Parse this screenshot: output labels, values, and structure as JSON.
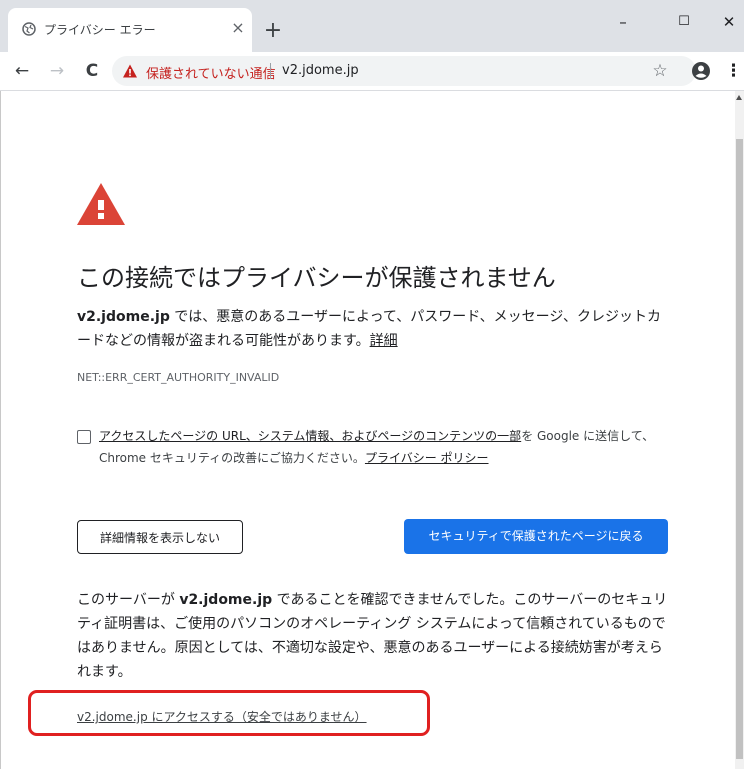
{
  "tab": {
    "title": "プライバシー エラー",
    "close_glyph": "×",
    "favicon": "globe-icon"
  },
  "newtab_glyph": "+",
  "window_controls": {
    "minimize": "–",
    "maximize": "☐",
    "close": "✕"
  },
  "toolbar": {
    "back_glyph": "←",
    "forward_glyph": "→",
    "reload_glyph": "C",
    "security_label": "保護されていない通信",
    "url": "v2.jdome.jp",
    "star_glyph": "☆",
    "menu_glyph": "⋮"
  },
  "page": {
    "heading": "この接続ではプライバシーが保護されません",
    "p1_domain": "v2.jdome.jp",
    "p1_text": " では、悪意のあるユーザーによって、パスワード、メッセージ、クレジットカードなどの情報が盗まれる可能性があります。",
    "p1_link": "詳細",
    "error_code": "NET::ERR_CERT_AUTHORITY_INVALID",
    "checkbox": {
      "checked": false,
      "text_link": "アクセスしたページの URL、システム情報、およびページのコンテンツの一部",
      "text_mid": "を Google に送信して、Chrome セキュリティの改善にご協力ください。",
      "policy_link": "プライバシー ポリシー"
    },
    "details_button": "詳細情報を表示しない",
    "back_button": "セキュリティで保護されたページに戻る",
    "p4_prefix": "このサーバーが ",
    "p4_domain": "v2.jdome.jp",
    "p4_text": " であることを確認できませんでした。このサーバーのセキュリティ証明書は、ご使用のパソコンのオペレーティング システムによって信頼されているものではありません。原因としては、不適切な設定や、悪意のあるユーザーによる接続妨害が考えられます。",
    "proceed_link": "v2.jdome.jp にアクセスする（安全ではありません）"
  },
  "colors": {
    "warning_red": "#db4437",
    "not_secure_red": "#c5221f",
    "primary_blue": "#1a73e8",
    "highlight_red": "#e02020"
  }
}
